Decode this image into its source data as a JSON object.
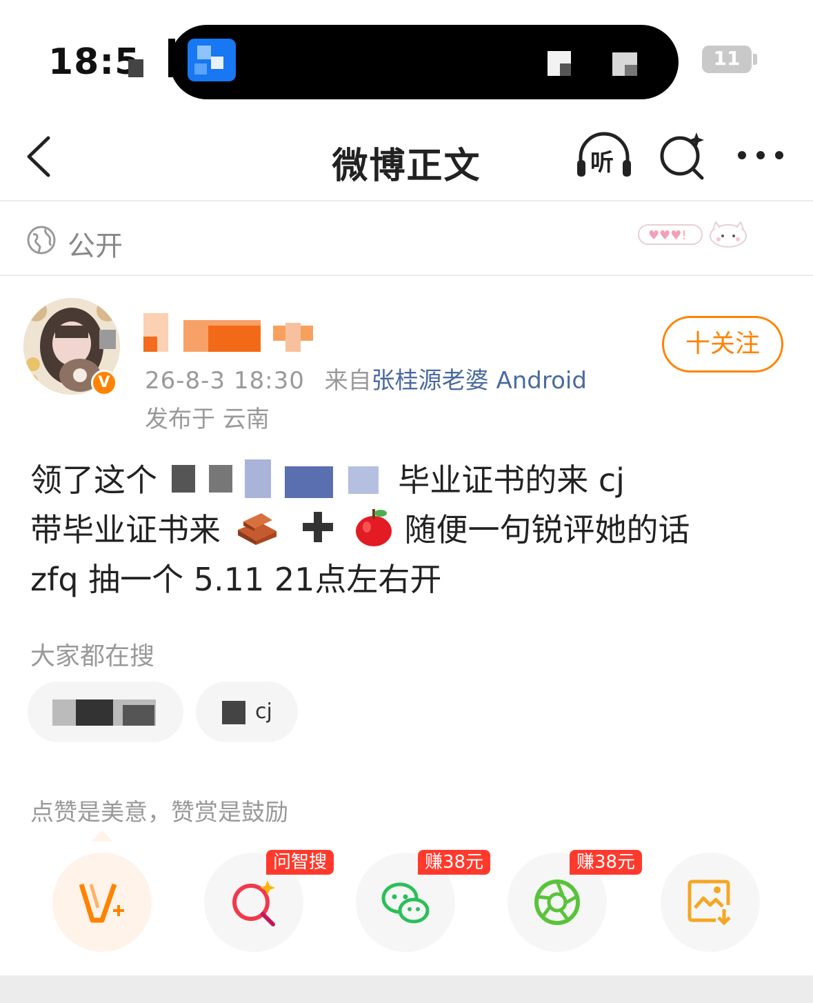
{
  "status_bar": {
    "time": "18:5"
  },
  "nav": {
    "title": "微博正文",
    "listen_label": "听"
  },
  "visibility": {
    "label": "公开"
  },
  "author": {
    "verified_badge": "V",
    "follow_label": "十关注",
    "time": "26-8-3 18:30",
    "source_prefix": "来自",
    "source": "张桂源老婆 Android",
    "location": "发布于 云南"
  },
  "post": {
    "line1_start": "领了这个",
    "line1_end": "毕业证书的来 cj",
    "line2_start": "带毕业证书来",
    "line2_end": "随便一句锐评她的话",
    "line3": "zfq 抽一个 5.11 21点左右开"
  },
  "trending": {
    "label": "大家都在搜",
    "chip2_suffix": "cj"
  },
  "tip": {
    "text": "点赞是美意，赞赏是鼓励"
  },
  "actions": [
    {
      "name": "vplus",
      "badge": ""
    },
    {
      "name": "ai-search",
      "badge": "问智搜"
    },
    {
      "name": "wechat",
      "badge": "赚38元"
    },
    {
      "name": "moments",
      "badge": "赚38元"
    },
    {
      "name": "save-image",
      "badge": ""
    }
  ],
  "colors": {
    "accent": "#ff8200",
    "link": "#4b6a9e",
    "badge_red": "#ff3a2d",
    "wechat_green": "#2bbf5a",
    "moments_green": "#5ac33b"
  }
}
